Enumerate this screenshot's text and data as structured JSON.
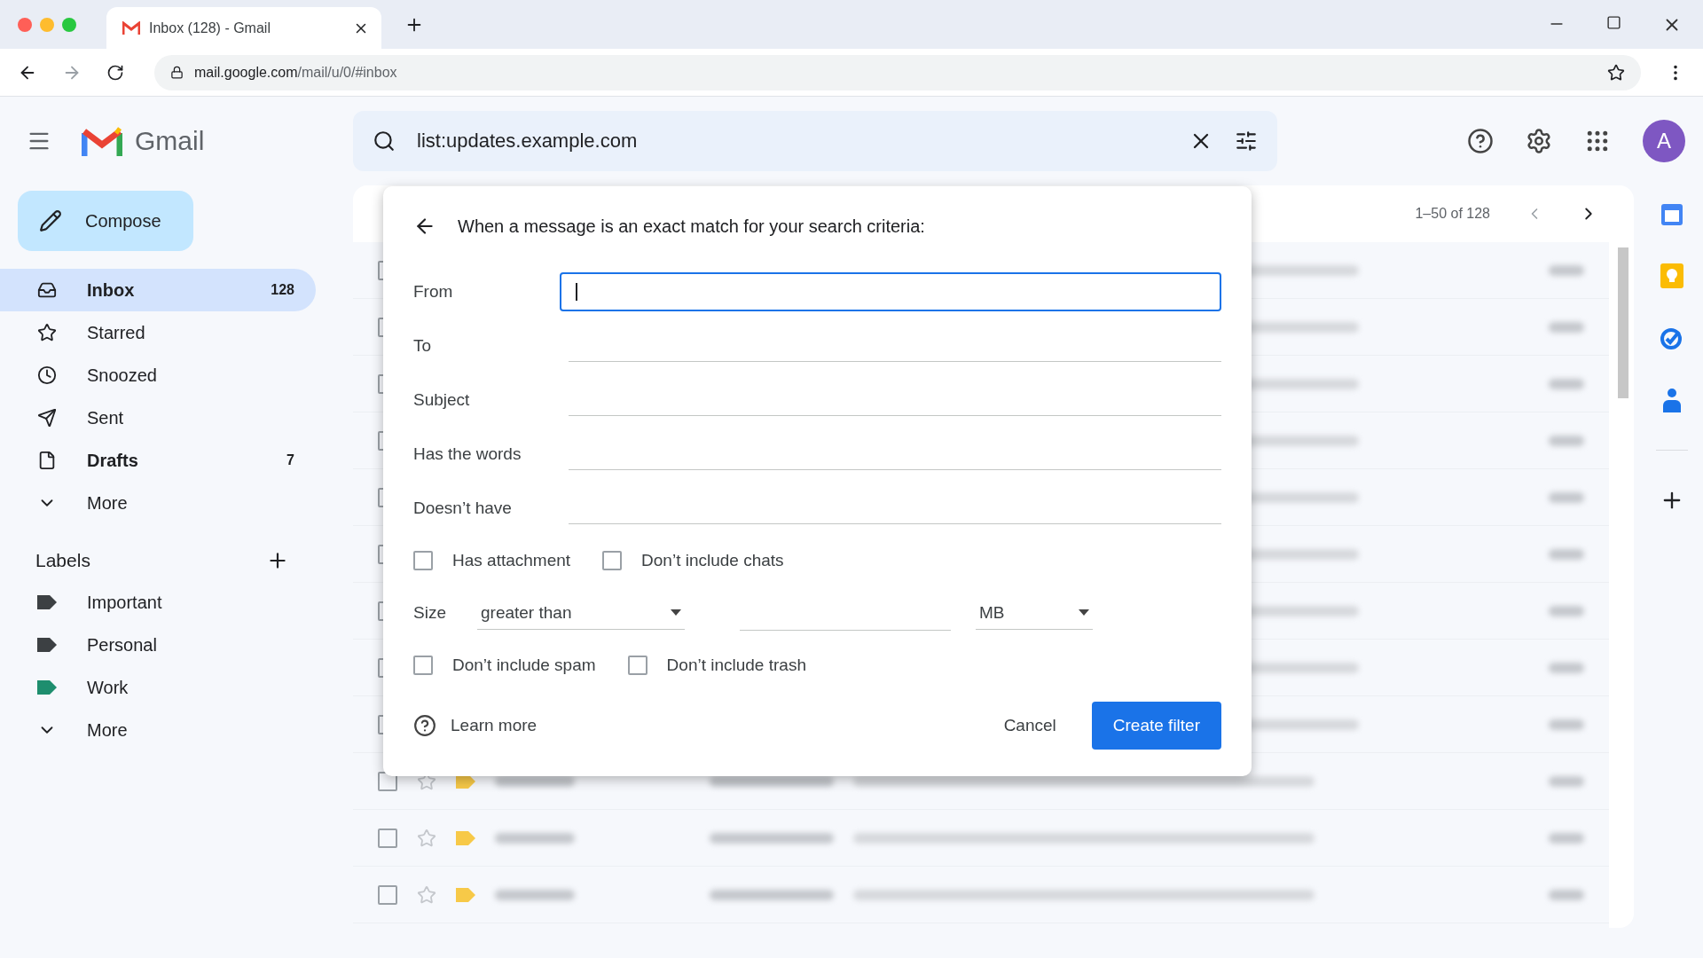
{
  "browser": {
    "tab_title": "Inbox (128) - Gmail",
    "url_host": "mail.google.com",
    "url_path": "/mail/u/0/#inbox"
  },
  "header": {
    "brand": "Gmail",
    "search_query": "list:updates.example.com",
    "avatar_letter": "A"
  },
  "compose": "Compose",
  "nav": [
    {
      "kind": "inbox",
      "label": "Inbox",
      "count": "128",
      "selected": true,
      "bold": true
    },
    {
      "kind": "starred",
      "label": "Starred",
      "selected": false,
      "bold": false
    },
    {
      "kind": "snoozed",
      "label": "Snoozed",
      "selected": false,
      "bold": false
    },
    {
      "kind": "sent",
      "label": "Sent",
      "selected": false,
      "bold": false
    },
    {
      "kind": "drafts",
      "label": "Drafts",
      "count": "7",
      "selected": false,
      "bold": true
    },
    {
      "kind": "more",
      "label": "More",
      "selected": false,
      "bold": false
    }
  ],
  "labels": {
    "heading": "Labels",
    "items": [
      {
        "kind": "label",
        "label": "Important",
        "color": "#3c4043"
      },
      {
        "kind": "label",
        "label": "Personal",
        "color": "#3c4043"
      },
      {
        "kind": "label",
        "label": "Work",
        "color": "#1e8e6e"
      },
      {
        "kind": "more",
        "label": "More"
      }
    ]
  },
  "list": {
    "range": "1–50 of 128",
    "rows": [
      {
        "checked": false
      },
      {
        "checked": false
      },
      {
        "checked": false
      },
      {
        "checked": false
      },
      {
        "checked": false
      },
      {
        "checked": false
      },
      {
        "checked": false
      },
      {
        "checked": false
      },
      {
        "checked": false
      },
      {
        "checked": false,
        "starred": false
      },
      {
        "checked": false,
        "starred": false
      },
      {
        "checked": false,
        "starred": false
      }
    ]
  },
  "dialog": {
    "heading": "When a message is an exact match for your search criteria:",
    "fields": [
      {
        "label": "From",
        "focused": true
      },
      {
        "label": "To",
        "focused": false
      },
      {
        "label": "Subject",
        "focused": false
      },
      {
        "label": "Has the words",
        "focused": false
      },
      {
        "label": "Doesn’t have",
        "focused": false
      }
    ],
    "checkboxes_top": [
      {
        "label": "Has attachment",
        "checked": false
      },
      {
        "label": "Don’t include chats",
        "checked": false
      }
    ],
    "size": {
      "label": "Size",
      "operator": "greater than",
      "unit": "MB"
    },
    "checkboxes_bottom": [
      {
        "label": "Don’t include spam",
        "checked": false
      },
      {
        "label": "Don’t include trash",
        "checked": false
      }
    ],
    "learn_more": "Learn more",
    "cancel": "Cancel",
    "create": "Create filter"
  }
}
